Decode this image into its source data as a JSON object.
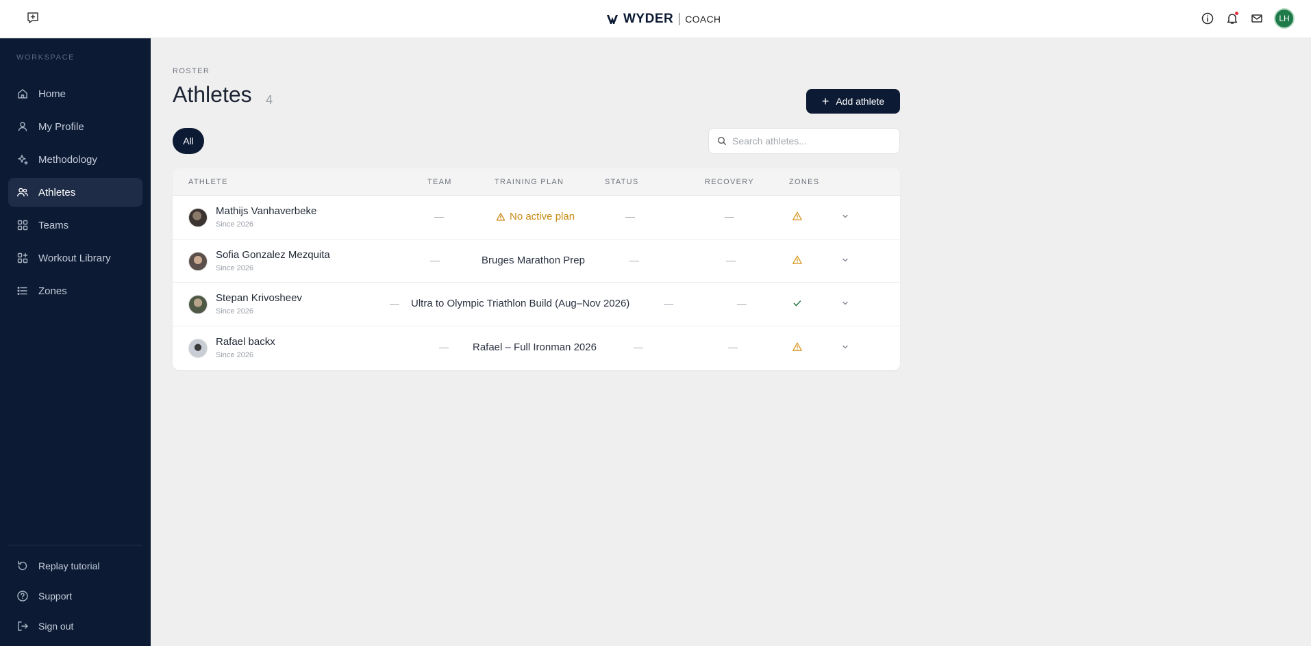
{
  "topbar": {
    "brand_name": "WYDER",
    "brand_sub": "COACH",
    "user_initials": "LH",
    "notification_badge_color": "#e0323c",
    "icons": [
      "feedback-icon",
      "info-icon",
      "bell-icon",
      "mail-icon"
    ]
  },
  "sidebar": {
    "section_label": "WORKSPACE",
    "items": [
      {
        "label": "Home",
        "icon": "home-icon"
      },
      {
        "label": "My Profile",
        "icon": "user-icon"
      },
      {
        "label": "Methodology",
        "icon": "sparkles-icon"
      },
      {
        "label": "Athletes",
        "icon": "users-icon",
        "active": true
      },
      {
        "label": "Teams",
        "icon": "grid-icon"
      },
      {
        "label": "Workout Library",
        "icon": "library-icon"
      },
      {
        "label": "Zones",
        "icon": "list-icon"
      }
    ],
    "bottom_items": [
      {
        "label": "Replay tutorial",
        "icon": "replay-icon"
      },
      {
        "label": "Support",
        "icon": "help-icon"
      },
      {
        "label": "Sign out",
        "icon": "sign-out-icon"
      }
    ]
  },
  "main": {
    "eyebrow": "ROSTER",
    "title": "Athletes",
    "count": "4",
    "add_button_label": "Add athlete",
    "filter_all_label": "All",
    "search_placeholder": "Search athletes..."
  },
  "table": {
    "headers": {
      "athlete": "ATHLETE",
      "team": "TEAM",
      "training_plan": "TRAINING PLAN",
      "status": "STATUS",
      "recovery": "RECOVERY",
      "zones": "ZONES"
    },
    "rows": [
      {
        "name": "Mathijs Vanhaverbeke",
        "since": "Since 2026",
        "team": "—",
        "plan": "No active plan",
        "plan_warning": true,
        "status": "—",
        "recovery": "—",
        "zones": "warning"
      },
      {
        "name": "Sofia Gonzalez Mezquita",
        "since": "Since 2026",
        "team": "—",
        "plan": "Bruges Marathon Prep",
        "plan_warning": false,
        "status": "—",
        "recovery": "—",
        "zones": "warning"
      },
      {
        "name": "Stepan Krivosheev",
        "since": "Since 2026",
        "team": "—",
        "plan": "Ultra to Olympic Triathlon Build (Aug–Nov 2026)",
        "plan_warning": false,
        "status": "—",
        "recovery": "—",
        "zones": "ok"
      },
      {
        "name": "Rafael backx",
        "since": "Since 2026",
        "team": "—",
        "plan": "Rafael – Full Ironman 2026",
        "plan_warning": false,
        "status": "—",
        "recovery": "—",
        "zones": "warning"
      }
    ]
  },
  "colors": {
    "navy": "#0c1a33",
    "warning": "#d89a2a",
    "ok": "#2f7a4f",
    "background": "#efefef"
  }
}
